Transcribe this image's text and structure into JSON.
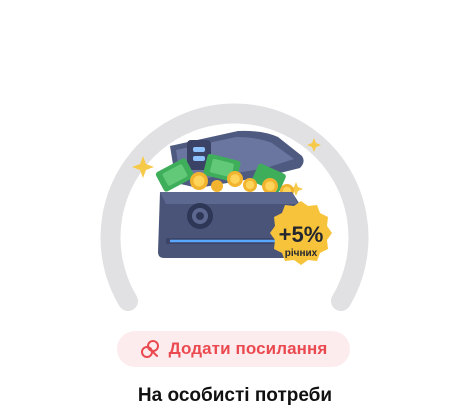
{
  "jar": {
    "progress_fraction": 0,
    "badge": {
      "value": "+5%",
      "caption": "річних"
    },
    "illustration_icon": "treasure-chest-icon"
  },
  "link_button": {
    "label": "Додати посилання",
    "icon": "link-icon",
    "color": "#ea4a4f",
    "background": "#fdeced"
  },
  "jar_title": "На особисті потреби"
}
